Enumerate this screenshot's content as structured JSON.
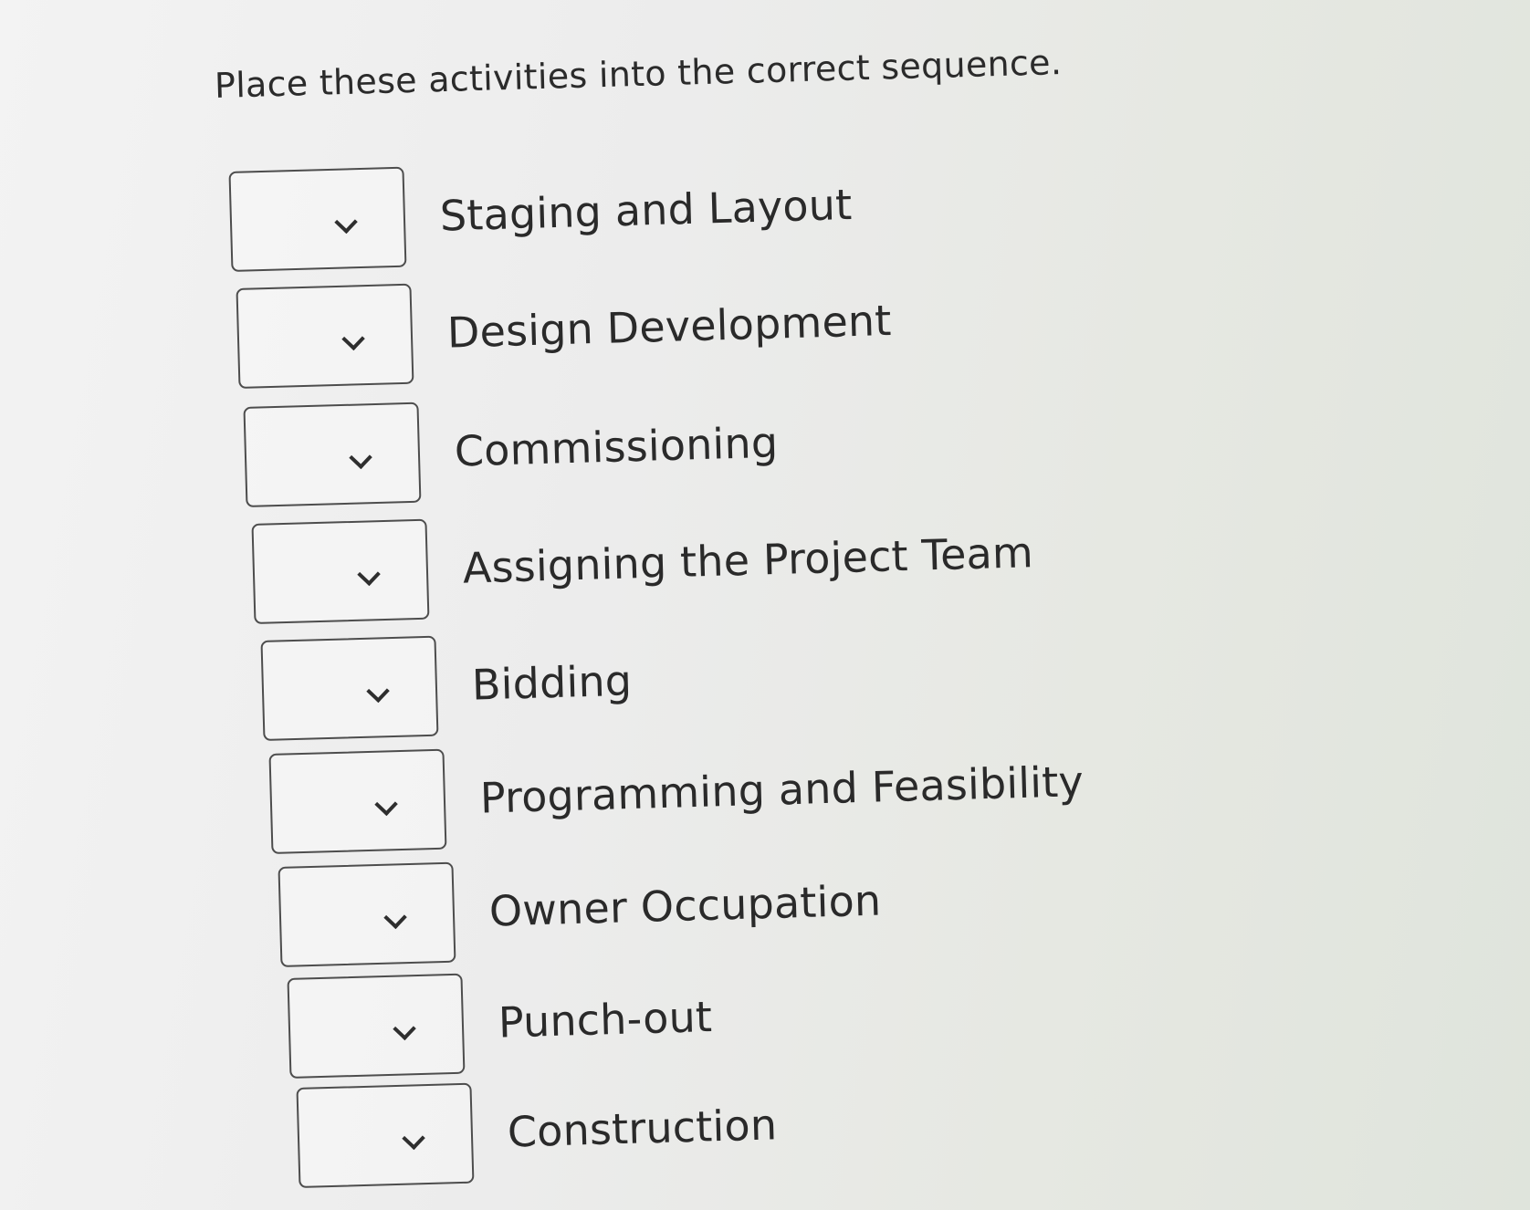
{
  "prompt": "Place these activities into the correct sequence.",
  "activities": [
    {
      "label": "Staging and Layout",
      "selected": ""
    },
    {
      "label": "Design Development",
      "selected": ""
    },
    {
      "label": "Commissioning",
      "selected": ""
    },
    {
      "label": "Assigning the Project Team",
      "selected": ""
    },
    {
      "label": "Bidding",
      "selected": ""
    },
    {
      "label": "Programming and Feasibility",
      "selected": ""
    },
    {
      "label": "Owner Occupation",
      "selected": ""
    },
    {
      "label": "Punch-out",
      "selected": ""
    },
    {
      "label": "Construction",
      "selected": ""
    }
  ],
  "icons": {
    "dropdown": "chevron-down-icon"
  }
}
